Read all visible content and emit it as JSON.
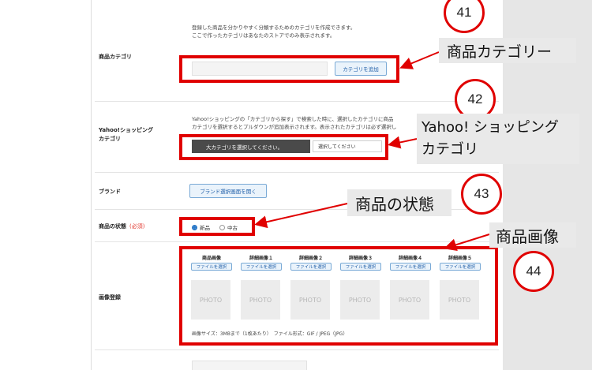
{
  "category": {
    "label": "商品カテゴリ",
    "desc_lines": [
      "登録した商品を分かりやすく分類するためのカテゴリを作成できます。",
      "ここで作ったカテゴリはあなたのストアでのみ表示されます。"
    ],
    "add_button": "カテゴリを追加",
    "input_value": ""
  },
  "yahoo": {
    "label_lines": [
      "Yahoo!ショッピング",
      "カテゴリ"
    ],
    "desc_lines": [
      "Yahoo!ショッピングの「カテゴリから探す」で検索した時に、選択したカテゴリに商品",
      "カテゴリを選択するとプルダウンが追加表示されます。表示されたカテゴリは必ず選択し"
    ],
    "major_select": "大カテゴリを選択してください。",
    "sub_select": "選択してください"
  },
  "brand": {
    "label": "ブランド",
    "button": "ブランド選択画面を開く"
  },
  "condition": {
    "label": "商品の状態",
    "required": "(必須)",
    "options": [
      "新品",
      "中古"
    ],
    "selected": "新品"
  },
  "images": {
    "label": "画像登録",
    "columns": [
      {
        "title": "商品画像",
        "button": "ファイルを選択",
        "photo": "PHOTO"
      },
      {
        "title": "詳細画像１",
        "button": "ファイルを選択",
        "photo": "PHOTO"
      },
      {
        "title": "詳細画像２",
        "button": "ファイルを選択",
        "photo": "PHOTO"
      },
      {
        "title": "詳細画像３",
        "button": "ファイルを選択",
        "photo": "PHOTO"
      },
      {
        "title": "詳細画像４",
        "button": "ファイルを選択",
        "photo": "PHOTO"
      },
      {
        "title": "詳細画像５",
        "button": "ファイルを選択",
        "photo": "PHOTO"
      }
    ],
    "note": "画像サイズ：3MBまで（1枚あたり）　ファイル形式：GIF / JPEG（JPG）"
  },
  "annotations": {
    "n41": "41",
    "n42": "42",
    "n43": "43",
    "n44": "44",
    "callout_category": "商品カテゴリー",
    "callout_yahoo_lines": [
      "Yahoo! ショッピング",
      "カテゴリ"
    ],
    "callout_condition": "商品の状態",
    "callout_images": "商品画像"
  },
  "colors": {
    "annotation_red": "#e00000",
    "link_blue": "#1f5ea8",
    "radio_blue": "#2b79c8",
    "required_red": "#e2382f"
  }
}
